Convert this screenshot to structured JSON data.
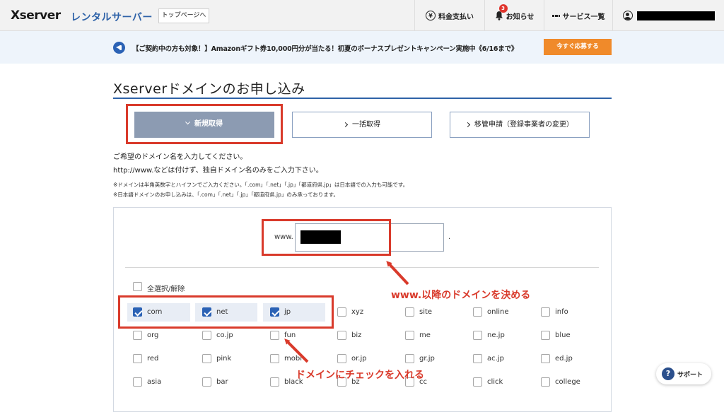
{
  "header": {
    "logo": "Xserver",
    "logo_sub": "レンタルサーバー",
    "top_page": "トップページへ",
    "nav": {
      "payment": "料金支払い",
      "notifications": "お知らせ",
      "notification_count": "3",
      "services": "サービス一覧"
    }
  },
  "banner": {
    "text": "【ご契約中の方も対象！】Amazonギフト券10,000円分が当たる！初夏のボーナスプレゼントキャンペーン実施中《6/16まで》",
    "cta": "今すぐ応募する"
  },
  "page": {
    "title": "Xserverドメインのお申し込み",
    "tabs": [
      {
        "label": "新規取得",
        "active": true
      },
      {
        "label": "一括取得",
        "active": false
      },
      {
        "label": "移管申請（登録事業者の変更）",
        "active": false
      }
    ],
    "instructions": [
      "ご希望のドメイン名を入力してください。",
      "http://www.などは付けず、独自ドメイン名のみをご入力下さい。"
    ],
    "notes": [
      "※ドメインは半角英数字とハイフンでご入力ください。「.com」「.net」「.jp」「都道府県.jp」は日本語での入力も可能です。",
      "※日本語ドメインのお申し込みは、「.com」「.net」「.jp」「都道府県.jp」のみ承っております。"
    ]
  },
  "form": {
    "prefix": "www.",
    "suffix": ".",
    "select_all": "全選択/解除",
    "tlds": [
      {
        "label": "com",
        "checked": true
      },
      {
        "label": "net",
        "checked": true
      },
      {
        "label": "jp",
        "checked": true
      },
      {
        "label": "xyz",
        "checked": false
      },
      {
        "label": "site",
        "checked": false
      },
      {
        "label": "online",
        "checked": false
      },
      {
        "label": "info",
        "checked": false
      },
      {
        "label": "org",
        "checked": false
      },
      {
        "label": "co.jp",
        "checked": false
      },
      {
        "label": "fun",
        "checked": false
      },
      {
        "label": "biz",
        "checked": false
      },
      {
        "label": "me",
        "checked": false
      },
      {
        "label": "ne.jp",
        "checked": false
      },
      {
        "label": "blue",
        "checked": false
      },
      {
        "label": "red",
        "checked": false
      },
      {
        "label": "pink",
        "checked": false
      },
      {
        "label": "mobi",
        "checked": false
      },
      {
        "label": "or.jp",
        "checked": false
      },
      {
        "label": "gr.jp",
        "checked": false
      },
      {
        "label": "ac.jp",
        "checked": false
      },
      {
        "label": "ed.jp",
        "checked": false
      },
      {
        "label": "asia",
        "checked": false
      },
      {
        "label": "bar",
        "checked": false
      },
      {
        "label": "black",
        "checked": false
      },
      {
        "label": "bz",
        "checked": false
      },
      {
        "label": "cc",
        "checked": false
      },
      {
        "label": "click",
        "checked": false
      },
      {
        "label": "college",
        "checked": false
      }
    ]
  },
  "annotations": {
    "domain_note": "www.以降のドメインを決める",
    "check_note": "ドメインにチェックを入れる"
  },
  "support": {
    "icon": "?",
    "label": "サポート"
  },
  "colors": {
    "brand_blue": "#2e62a8",
    "cta_orange": "#f08a2a",
    "annotation_red": "#d93a2b",
    "active_tab": "#8c9bb2"
  }
}
